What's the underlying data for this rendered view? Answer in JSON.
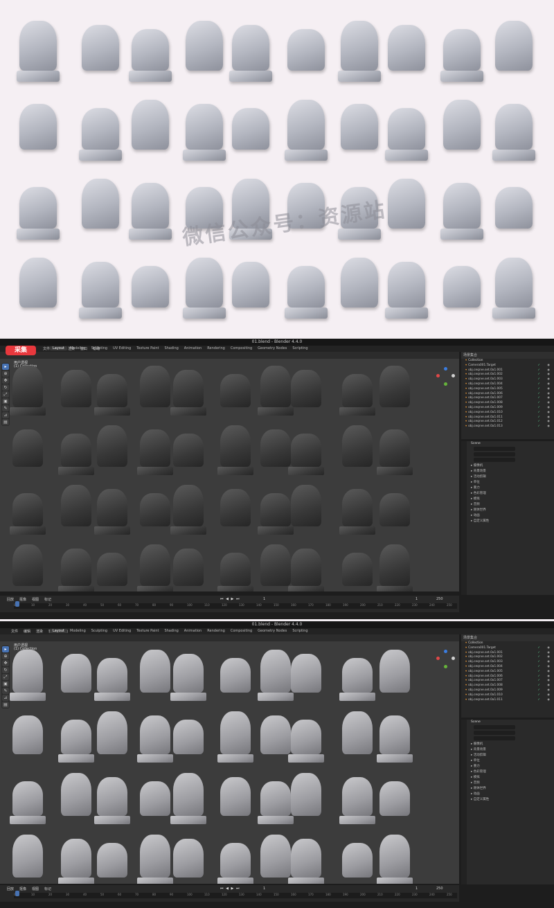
{
  "watermark": "微信公众号：资源站",
  "badge": "采集",
  "blender_top": {
    "title": "01.blend - Blender 4.4.0",
    "menu": [
      "文件",
      "编辑",
      "渲染",
      "窗口",
      "帮助"
    ],
    "workspaces": [
      "Layout",
      "Modeling",
      "Sculpting",
      "UV Editing",
      "Texture Paint",
      "Shading",
      "Animation",
      "Rendering",
      "Compositing",
      "Geometry Nodes",
      "Scripting"
    ],
    "viewport_label": "用户透视",
    "viewport_sublabel": "(1) Collection",
    "outliner_title": "场景集合",
    "collection_name": "Collection",
    "items": [
      "Camera001.Target",
      "obj.ceqrve.set.0a1.001",
      "obj.ceqrve.set.0a1.002",
      "obj.ceqrve.set.0a1.003",
      "obj.ceqrve.set.0a1.004",
      "obj.ceqrve.set.0a1.005",
      "obj.ceqrve.set.0a1.006",
      "obj.ceqrve.set.0a1.007",
      "obj.ceqrve.set.0a1.008",
      "obj.ceqrve.set.0a1.009",
      "obj.ceqrve.set.0a1.010",
      "obj.ceqrve.set.0a1.011",
      "obj.ceqrve.set.0a1.012",
      "obj.ceqrve.set.0a1.013"
    ],
    "props_title": "Scene",
    "props_rows": [
      "摄像机",
      "背景场景",
      "活动剪辑",
      "单位",
      "重力",
      "色彩管理",
      "模拟",
      "音频",
      "刚体世界",
      "动画",
      "自定义属性"
    ],
    "timeline_menu": [
      "回放",
      "抠像",
      "视图",
      "标记"
    ],
    "frame_current": "1",
    "frame_start": "1",
    "frame_end": "250"
  },
  "blender_bottom": {
    "title": "01.blend - Blender 4.4.0",
    "menu": [
      "文件",
      "编辑",
      "渲染",
      "窗口",
      "帮助"
    ],
    "workspaces": [
      "Layout",
      "Modeling",
      "Sculpting",
      "UV Editing",
      "Texture Paint",
      "Shading",
      "Animation",
      "Rendering",
      "Compositing",
      "Geometry Nodes",
      "Scripting"
    ],
    "viewport_label": "用户透视",
    "viewport_sublabel": "(1) Collection",
    "outliner_title": "场景集合",
    "collection_name": "Collection",
    "items": [
      "Camera001.Target",
      "obj.ceqrve.set.0a1.001",
      "obj.ceqrve.set.0a1.002",
      "obj.ceqrve.set.0a1.003",
      "obj.ceqrve.set.0a1.004",
      "obj.ceqrve.set.0a1.005",
      "obj.ceqrve.set.0a1.006",
      "obj.ceqrve.set.0a1.007",
      "obj.ceqrve.set.0a1.008",
      "obj.ceqrve.set.0a1.009",
      "obj.ceqrve.set.0a1.010",
      "obj.ceqrve.set.0a1.011"
    ],
    "props_title": "Scene",
    "props_rows": [
      "摄像机",
      "背景场景",
      "活动剪辑",
      "单位",
      "重力",
      "色彩管理",
      "模拟",
      "音频",
      "刚体世界",
      "动画",
      "自定义属性"
    ],
    "timeline_menu": [
      "回放",
      "抠像",
      "视图",
      "标记"
    ],
    "frame_current": "1",
    "frame_start": "1",
    "frame_end": "250"
  },
  "timeline_ticks": [
    "0",
    "10",
    "20",
    "30",
    "40",
    "50",
    "60",
    "70",
    "80",
    "90",
    "100",
    "110",
    "120",
    "130",
    "140",
    "150",
    "160",
    "170",
    "180",
    "190",
    "200",
    "210",
    "220",
    "230",
    "240",
    "250"
  ],
  "colors": {
    "accent": "#4772b3",
    "badge": "#e8383d",
    "check": "#5fcf8f",
    "object_tri": "#e3943a"
  }
}
